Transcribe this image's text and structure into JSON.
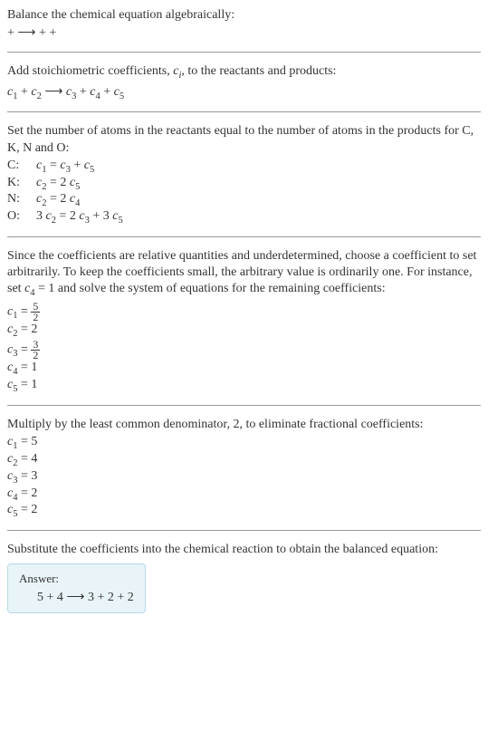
{
  "section1": {
    "title": "Balance the chemical equation algebraically:",
    "eq": " +  ⟶  +  + "
  },
  "section2": {
    "title_part1": "Add stoichiometric coefficients, ",
    "title_ci": "c",
    "title_ci_sub": "i",
    "title_part2": ", to the reactants and products:",
    "eq_c1": "c",
    "eq_1": "1",
    "eq_plus1": " + ",
    "eq_c2": "c",
    "eq_2": "2",
    "eq_arrow": "  ⟶ ",
    "eq_c3": "c",
    "eq_3": "3",
    "eq_plus2": " + ",
    "eq_c4": "c",
    "eq_4": "4",
    "eq_plus3": " + ",
    "eq_c5": "c",
    "eq_5": "5"
  },
  "section3": {
    "title": "Set the number of atoms in the reactants equal to the number of atoms in the products for C, K, N and O:",
    "rows": [
      {
        "label": "C:",
        "eq_pre": "c",
        "s1": "1",
        "mid": " = c",
        "s2": "3",
        "mid2": " + c",
        "s3": "5",
        "tail": ""
      },
      {
        "label": "K:",
        "eq_pre": "c",
        "s1": "2",
        "mid": " = 2 c",
        "s2": "5",
        "mid2": "",
        "s3": "",
        "tail": ""
      },
      {
        "label": "N:",
        "eq_pre": "c",
        "s1": "2",
        "mid": " = 2 c",
        "s2": "4",
        "mid2": "",
        "s3": "",
        "tail": ""
      },
      {
        "label": "O:",
        "eq_pre": "3 c",
        "s1": "2",
        "mid": " = 2 c",
        "s2": "3",
        "mid2": " + 3 c",
        "s3": "5",
        "tail": ""
      }
    ]
  },
  "section4": {
    "title_p1": "Since the coefficients are relative quantities and underdetermined, choose a coefficient to set arbitrarily. To keep the coefficients small, the arbitrary value is ordinarily one. For instance, set ",
    "title_c4": "c",
    "title_c4_sub": "4",
    "title_p2": " = 1 and solve the system of equations for the remaining coefficients:",
    "c1_label": "c",
    "c1_sub": "1",
    "c1_eq": " = ",
    "c1_num": "5",
    "c1_den": "2",
    "c2_label": "c",
    "c2_sub": "2",
    "c2_val": " = 2",
    "c3_label": "c",
    "c3_sub": "3",
    "c3_eq": " = ",
    "c3_num": "3",
    "c3_den": "2",
    "c4_label": "c",
    "c4_sub": "4",
    "c4_val": " = 1",
    "c5_label": "c",
    "c5_sub": "5",
    "c5_val": " = 1"
  },
  "section5": {
    "title": "Multiply by the least common denominator, 2, to eliminate fractional coefficients:",
    "lines": [
      {
        "c": "c",
        "sub": "1",
        "val": " = 5"
      },
      {
        "c": "c",
        "sub": "2",
        "val": " = 4"
      },
      {
        "c": "c",
        "sub": "3",
        "val": " = 3"
      },
      {
        "c": "c",
        "sub": "4",
        "val": " = 2"
      },
      {
        "c": "c",
        "sub": "5",
        "val": " = 2"
      }
    ]
  },
  "section6": {
    "title": "Substitute the coefficients into the chemical reaction to obtain the balanced equation:",
    "answer_label": "Answer:",
    "answer_eq": "5  + 4  ⟶ 3  + 2  + 2 "
  }
}
